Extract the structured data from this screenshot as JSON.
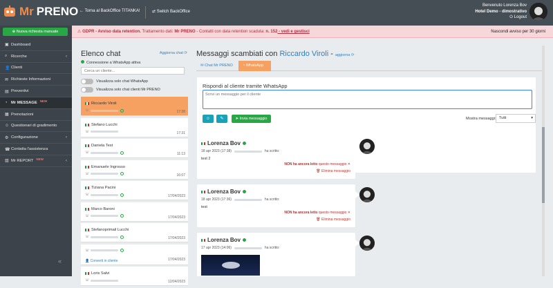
{
  "topbar": {
    "logo_mr": "Mr",
    "logo_preno": "PRENO",
    "back_link": "← Torna al BackOffice TITANKA!",
    "switch_link": "⇄ Switch BackOffice",
    "user_greeting": "Benvenuto Lorenza Bov",
    "user_hotel": "Hotel Demo - dimostrativo",
    "logout": "⏻ Logout"
  },
  "sidebar": {
    "new_request": "Nuova richiesta manuale",
    "items": [
      {
        "icon": "▣",
        "label": "Dashboard",
        "chev": "",
        "badge": ""
      },
      {
        "icon": "⌕",
        "label": "Ricerche",
        "chev": "‹",
        "badge": ""
      },
      {
        "icon": "👤",
        "label": "Clienti",
        "chev": "",
        "badge": ""
      },
      {
        "icon": "✉",
        "label": "Richieste Informazioni",
        "chev": "",
        "badge": ""
      },
      {
        "icon": "▤",
        "label": "Preventivi",
        "chev": "",
        "badge": ""
      },
      {
        "icon": "◔",
        "label": "Mr MESSAGE",
        "chev": "",
        "badge": "NEW"
      },
      {
        "icon": "▦",
        "label": "Prenotazioni",
        "chev": "",
        "badge": ""
      },
      {
        "icon": "☺",
        "label": "Questionari di gradimento",
        "chev": "",
        "badge": ""
      },
      {
        "icon": "⚙",
        "label": "Configurazione",
        "chev": "‹",
        "badge": ""
      },
      {
        "icon": "☎",
        "label": "Contatta l'assistenza",
        "chev": "",
        "badge": ""
      },
      {
        "icon": "▥",
        "label": "Mr REPORT",
        "chev": "‹",
        "badge": "NEW"
      }
    ],
    "collapse": "«"
  },
  "alert": {
    "prefix": "⚠",
    "text_strong": "GDPR - Avviso data retention.",
    "text_normal": " Trattamento dati: ",
    "brand": "Mr PRENO",
    "text_tail": " - Contatti con data retention scaduta: ",
    "count": "n. 152",
    "link": " - vedi e gestisci",
    "hide": "Nascondi avviso per 30 giorni"
  },
  "chatlist": {
    "title": "Elenco chat",
    "refresh": "Aggiorna chat ⟳",
    "connection": "Connessione a WhatsApp attiva",
    "search_placeholder": "Cerca un cliente...",
    "toggle1": "Visualizza solo chat WhatsApp",
    "toggle2": "Visualizza solo chat clienti Mr PRENO",
    "items": [
      {
        "name": "Riccardo Viroli",
        "time": "17:38",
        "extra": ""
      },
      {
        "name": "Stefano Lucchi",
        "time": "17:31",
        "extra": ""
      },
      {
        "name": "Daniela Test",
        "time": "11:13",
        "extra": ""
      },
      {
        "name": "Emanuele Ingrosso",
        "time": "16:07",
        "extra": ""
      },
      {
        "name": "Tiziana Pacini",
        "time": "17/04/2023",
        "extra": ""
      },
      {
        "name": "Marco Baroni",
        "time": "17/04/2023",
        "extra": ""
      },
      {
        "name": "Stefanoprimail Lucchi",
        "time": "17/04/2023",
        "extra": ""
      },
      {
        "name": "",
        "time": "17/04/2023",
        "extra": "👤 Converti in cliente"
      },
      {
        "name": "Loris Salvi",
        "time": "12/04/2023",
        "extra": ""
      }
    ]
  },
  "messages": {
    "title_prefix": "Messaggi scambiati con ",
    "customer": "Riccardo Viroli",
    "title_sep": " - ",
    "refresh": "aggiorna ⟳",
    "tab_chat": "✉ Chat Mr PRENO",
    "tab_whatsapp": "◔ WhatsApp",
    "reply_label": "Rispondi al cliente tramite WhatsApp",
    "reply_placeholder": "Scrivi un messaggio per il cliente",
    "btn_emoji": "☺",
    "btn_attach": "✎",
    "btn_send": "➤ Invia messaggio",
    "show_label": "Mostra messaggi:",
    "show_value": "Tutti",
    "list": [
      {
        "author": "Lorenza Bov",
        "date": "18 apr 2023 (17:38)",
        "wrote": "ha scritto:",
        "text": "test 2",
        "status_strong": "NON ha ancora letto",
        "status_tail": " questo messaggio ✕",
        "delete": "🗑 Elimina messaggio",
        "has_image": false
      },
      {
        "author": "Lorenza Bov",
        "date": "18 apr 2023 (17:36)",
        "wrote": "ha scritto:",
        "text": "test",
        "status_strong": "NON ha ancora letto",
        "status_tail": " questo messaggio ✕",
        "delete": "🗑 Elimina messaggio",
        "has_image": false
      },
      {
        "author": "Lorenza Bov",
        "date": "17 apr 2023 (14:06)",
        "wrote": "ha scritto:",
        "text": "",
        "status_strong": "",
        "status_tail": "",
        "delete": "",
        "has_image": true
      }
    ]
  }
}
